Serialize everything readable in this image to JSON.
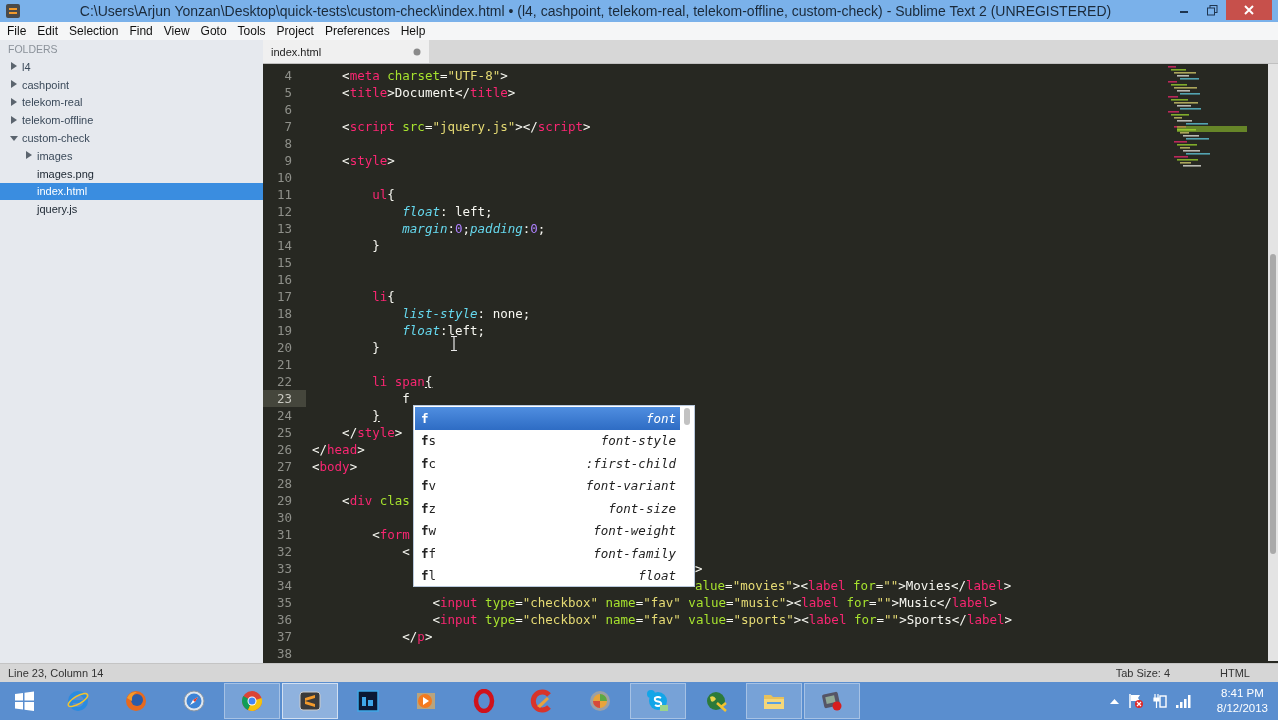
{
  "window": {
    "title": "C:\\Users\\Arjun Yonzan\\Desktop\\quick-tests\\custom-check\\index.html • (l4, cashpoint, telekom-real, telekom-offline, custom-check) - Sublime Text 2 (UNREGISTERED)"
  },
  "menu": [
    "File",
    "Edit",
    "Selection",
    "Find",
    "View",
    "Goto",
    "Tools",
    "Project",
    "Preferences",
    "Help"
  ],
  "sidebar": {
    "heading": "FOLDERS",
    "items": [
      {
        "name": "l4",
        "kind": "folder",
        "expanded": false,
        "selected": false
      },
      {
        "name": "cashpoint",
        "kind": "folder",
        "expanded": false,
        "selected": false
      },
      {
        "name": "telekom-real",
        "kind": "folder",
        "expanded": false,
        "selected": false
      },
      {
        "name": "telekom-offline",
        "kind": "folder",
        "expanded": false,
        "selected": false
      },
      {
        "name": "custom-check",
        "kind": "folder",
        "expanded": true,
        "selected": false,
        "children": [
          {
            "name": "images",
            "kind": "folder",
            "expanded": false,
            "selected": false
          },
          {
            "name": "images.png",
            "kind": "file",
            "selected": false
          },
          {
            "name": "index.html",
            "kind": "file",
            "selected": true
          },
          {
            "name": "jquery.js",
            "kind": "file",
            "selected": false
          }
        ]
      }
    ]
  },
  "editor": {
    "tab": {
      "label": "index.html",
      "modified": true
    },
    "lines": [
      {
        "number": "4",
        "current": false,
        "tokens": [
          {
            "kind": "punct",
            "text": "    <"
          },
          {
            "kind": "tag",
            "text": "meta"
          },
          {
            "kind": "attr",
            "text": " charset"
          },
          {
            "kind": "punct",
            "text": "="
          },
          {
            "kind": "string",
            "text": "\"UTF-8\""
          },
          {
            "kind": "punct",
            "text": ">"
          }
        ]
      },
      {
        "number": "5",
        "current": false,
        "tokens": [
          {
            "kind": "punct",
            "text": "    <"
          },
          {
            "kind": "tag",
            "text": "title"
          },
          {
            "kind": "punct",
            "text": ">Document</"
          },
          {
            "kind": "tag",
            "text": "title"
          },
          {
            "kind": "punct",
            "text": ">"
          }
        ]
      },
      {
        "number": "6",
        "current": false
      },
      {
        "number": "7",
        "current": false,
        "tokens": [
          {
            "kind": "punct",
            "text": "    <"
          },
          {
            "kind": "tag",
            "text": "script"
          },
          {
            "kind": "attr",
            "text": " src"
          },
          {
            "kind": "punct",
            "text": "="
          },
          {
            "kind": "string",
            "text": "\"jquery.js\""
          },
          {
            "kind": "punct",
            "text": "></"
          },
          {
            "kind": "tag",
            "text": "script"
          },
          {
            "kind": "punct",
            "text": ">"
          }
        ]
      },
      {
        "number": "8",
        "current": false
      },
      {
        "number": "9",
        "current": false,
        "tokens": [
          {
            "kind": "punct",
            "text": "    <"
          },
          {
            "kind": "tag",
            "text": "style"
          },
          {
            "kind": "punct",
            "text": ">"
          }
        ]
      },
      {
        "number": "10",
        "current": false
      },
      {
        "number": "11",
        "current": false,
        "tokens": [
          {
            "kind": "selector",
            "text": "        ul"
          },
          {
            "kind": "punct",
            "text": "{"
          }
        ]
      },
      {
        "number": "12",
        "current": false,
        "tokens": [
          {
            "kind": "property",
            "text": "            float"
          },
          {
            "kind": "punct",
            "text": ": left;"
          }
        ]
      },
      {
        "number": "13",
        "current": false,
        "tokens": [
          {
            "kind": "property",
            "text": "            margin"
          },
          {
            "kind": "punct",
            "text": ":"
          },
          {
            "kind": "number",
            "text": "0"
          },
          {
            "kind": "punct",
            "text": ";"
          },
          {
            "kind": "property",
            "text": "padding"
          },
          {
            "kind": "punct",
            "text": ":"
          },
          {
            "kind": "number",
            "text": "0"
          },
          {
            "kind": "punct",
            "text": ";"
          }
        ]
      },
      {
        "number": "14",
        "current": false,
        "tokens": [
          {
            "kind": "punct",
            "text": "        }"
          }
        ]
      },
      {
        "number": "15",
        "current": false
      },
      {
        "number": "16",
        "current": false
      },
      {
        "number": "17",
        "current": false,
        "tokens": [
          {
            "kind": "selector",
            "text": "        li"
          },
          {
            "kind": "punct",
            "text": "{"
          }
        ]
      },
      {
        "number": "18",
        "current": false,
        "tokens": [
          {
            "kind": "property",
            "text": "            list-style"
          },
          {
            "kind": "punct",
            "text": ": none;"
          }
        ]
      },
      {
        "number": "19",
        "current": false,
        "tokens": [
          {
            "kind": "property",
            "text": "            float"
          },
          {
            "kind": "punct",
            "text": ":left;"
          }
        ]
      },
      {
        "number": "20",
        "current": false,
        "tokens": [
          {
            "kind": "punct",
            "text": "        }"
          }
        ]
      },
      {
        "number": "21",
        "current": false
      },
      {
        "number": "22",
        "current": false,
        "tokens": [
          {
            "kind": "selector",
            "text": "        li span"
          },
          {
            "kind": "bracket-match",
            "text": "{"
          }
        ]
      },
      {
        "number": "23",
        "current": true,
        "tokens": [
          {
            "kind": "punct",
            "text": "            f"
          }
        ]
      },
      {
        "number": "24",
        "current": false,
        "tokens": [
          {
            "kind": "bracket-match",
            "text": "        }"
          }
        ]
      },
      {
        "number": "25",
        "current": false,
        "tokens": [
          {
            "kind": "punct",
            "text": "    </"
          },
          {
            "kind": "tag",
            "text": "style"
          },
          {
            "kind": "punct",
            "text": ">"
          }
        ]
      },
      {
        "number": "26",
        "current": false,
        "tokens": [
          {
            "kind": "punct",
            "text": "</"
          },
          {
            "kind": "tag",
            "text": "head"
          },
          {
            "kind": "punct",
            "text": ">"
          }
        ]
      },
      {
        "number": "27",
        "current": false,
        "tokens": [
          {
            "kind": "punct",
            "text": "<"
          },
          {
            "kind": "tag",
            "text": "body"
          },
          {
            "kind": "punct",
            "text": ">"
          }
        ]
      },
      {
        "number": "28",
        "current": false
      },
      {
        "number": "29",
        "current": false,
        "tokens": [
          {
            "kind": "punct",
            "text": "    <"
          },
          {
            "kind": "tag",
            "text": "div"
          },
          {
            "kind": "attr",
            "text": " clas"
          }
        ]
      },
      {
        "number": "30",
        "current": false
      },
      {
        "number": "31",
        "current": false,
        "tokens": [
          {
            "kind": "punct",
            "text": "        <"
          },
          {
            "kind": "tag",
            "text": "form"
          }
        ]
      },
      {
        "number": "32",
        "current": false,
        "tokens": [
          {
            "kind": "punct",
            "text": "            <"
          }
        ]
      },
      {
        "number": "33",
        "current": false,
        "covered": true,
        "tokens": [
          {
            "kind": "punct",
            "text": ">"
          }
        ]
      },
      {
        "number": "34",
        "current": false,
        "covered": true,
        "tokens": [
          {
            "kind": "attr",
            "text": "alue"
          },
          {
            "kind": "punct",
            "text": "="
          },
          {
            "kind": "string",
            "text": "\"movies\""
          },
          {
            "kind": "punct",
            "text": "><"
          },
          {
            "kind": "tag",
            "text": "label"
          },
          {
            "kind": "attr",
            "text": " for"
          },
          {
            "kind": "punct",
            "text": "="
          },
          {
            "kind": "string",
            "text": "\"\""
          },
          {
            "kind": "punct",
            "text": ">Movies</"
          },
          {
            "kind": "tag",
            "text": "label"
          },
          {
            "kind": "punct",
            "text": ">"
          }
        ]
      },
      {
        "number": "35",
        "current": false,
        "tokens": [
          {
            "kind": "punct",
            "text": "                <"
          },
          {
            "kind": "tag",
            "text": "input"
          },
          {
            "kind": "attr",
            "text": " type"
          },
          {
            "kind": "punct",
            "text": "="
          },
          {
            "kind": "string",
            "text": "\"checkbox\""
          },
          {
            "kind": "attr",
            "text": " name"
          },
          {
            "kind": "punct",
            "text": "="
          },
          {
            "kind": "string",
            "text": "\"fav\""
          },
          {
            "kind": "attr",
            "text": " value"
          },
          {
            "kind": "punct",
            "text": "="
          },
          {
            "kind": "string",
            "text": "\"music\""
          },
          {
            "kind": "punct",
            "text": "><"
          },
          {
            "kind": "tag",
            "text": "label"
          },
          {
            "kind": "attr",
            "text": " for"
          },
          {
            "kind": "punct",
            "text": "="
          },
          {
            "kind": "string",
            "text": "\"\""
          },
          {
            "kind": "punct",
            "text": ">Music</"
          },
          {
            "kind": "tag",
            "text": "label"
          },
          {
            "kind": "punct",
            "text": ">"
          }
        ]
      },
      {
        "number": "36",
        "current": false,
        "tokens": [
          {
            "kind": "punct",
            "text": "                <"
          },
          {
            "kind": "tag",
            "text": "input"
          },
          {
            "kind": "attr",
            "text": " type"
          },
          {
            "kind": "punct",
            "text": "="
          },
          {
            "kind": "string",
            "text": "\"checkbox\""
          },
          {
            "kind": "attr",
            "text": " name"
          },
          {
            "kind": "punct",
            "text": "="
          },
          {
            "kind": "string",
            "text": "\"fav\""
          },
          {
            "kind": "attr",
            "text": " value"
          },
          {
            "kind": "punct",
            "text": "="
          },
          {
            "kind": "string",
            "text": "\"sports\""
          },
          {
            "kind": "punct",
            "text": "><"
          },
          {
            "kind": "tag",
            "text": "label"
          },
          {
            "kind": "attr",
            "text": " for"
          },
          {
            "kind": "punct",
            "text": "="
          },
          {
            "kind": "string",
            "text": "\"\""
          },
          {
            "kind": "punct",
            "text": ">Sports</"
          },
          {
            "kind": "tag",
            "text": "label"
          },
          {
            "kind": "punct",
            "text": ">"
          }
        ]
      },
      {
        "number": "37",
        "current": false,
        "tokens": [
          {
            "kind": "punct",
            "text": "            </"
          },
          {
            "kind": "tag",
            "text": "p"
          },
          {
            "kind": "punct",
            "text": ">"
          }
        ]
      },
      {
        "number": "38",
        "current": false
      }
    ],
    "autocomplete": {
      "items": [
        {
          "trigger": "**f**",
          "completion": "font",
          "selected": true
        },
        {
          "trigger": "**f**s",
          "completion": "font-style",
          "selected": false
        },
        {
          "trigger": "**f**c",
          "completion": ":first-child",
          "selected": false
        },
        {
          "trigger": "**f**v",
          "completion": "font-variant",
          "selected": false
        },
        {
          "trigger": "**f**z",
          "completion": "font-size",
          "selected": false
        },
        {
          "trigger": "**f**w",
          "completion": "font-weight",
          "selected": false
        },
        {
          "trigger": "**f**f",
          "completion": "font-family",
          "selected": false
        },
        {
          "trigger": "**f**l",
          "completion": "float",
          "selected": false
        }
      ]
    }
  },
  "status_bar": {
    "position": "Line 23, Column 14",
    "tab_size": "Tab Size: 4",
    "syntax": "HTML"
  },
  "taskbar": {
    "apps": [
      {
        "kind": "start",
        "open": false,
        "selected": false
      },
      {
        "kind": "ie",
        "open": false,
        "selected": false
      },
      {
        "kind": "firefox",
        "open": false,
        "selected": false
      },
      {
        "kind": "safari",
        "open": false,
        "selected": false
      },
      {
        "kind": "chrome",
        "open": true,
        "selected": false
      },
      {
        "kind": "sublime",
        "open": true,
        "selected": true
      },
      {
        "kind": "photoshop",
        "open": false,
        "selected": false
      },
      {
        "kind": "player",
        "open": false,
        "selected": false
      },
      {
        "kind": "opera",
        "open": false,
        "selected": false
      },
      {
        "kind": "ccleaner",
        "open": false,
        "selected": false
      },
      {
        "kind": "ball",
        "open": false,
        "selected": false
      },
      {
        "kind": "skype",
        "open": true,
        "selected": false
      },
      {
        "kind": "globe",
        "open": false,
        "selected": false
      },
      {
        "kind": "folder",
        "open": true,
        "selected": false
      },
      {
        "kind": "recorder",
        "open": true,
        "selected": false
      }
    ],
    "clock": {
      "time": "8:41 PM",
      "date": "8/12/2013"
    }
  }
}
